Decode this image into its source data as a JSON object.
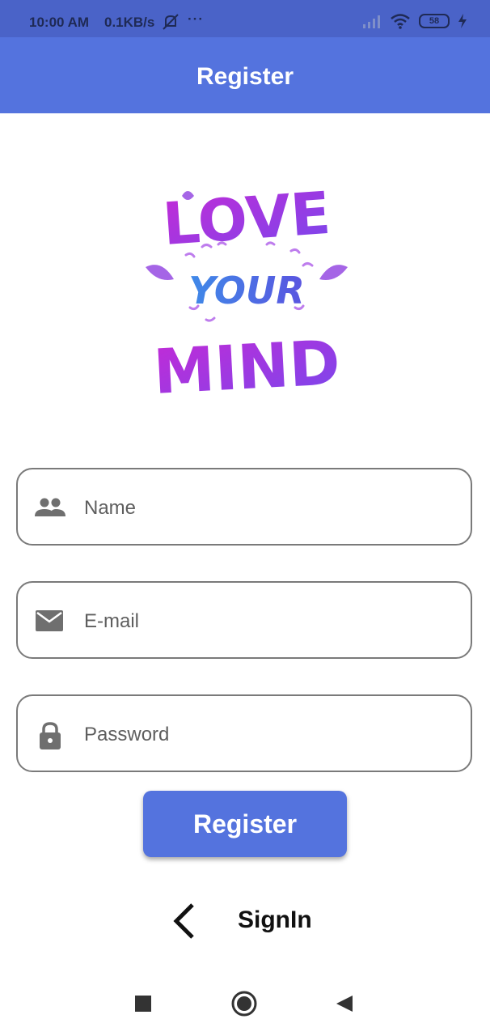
{
  "status_bar": {
    "time": "10:00 AM",
    "speed": "0.1KB/s",
    "dots": "···",
    "battery": "58"
  },
  "app_bar": {
    "title": "Register"
  },
  "logo": {
    "line1": "LOVE",
    "line2": "YOUR",
    "line3": "MIND"
  },
  "form": {
    "name": {
      "placeholder": "Name",
      "icon": "people-icon"
    },
    "email": {
      "placeholder": "E-mail",
      "icon": "mail-icon"
    },
    "password": {
      "placeholder": "Password",
      "icon": "lock-icon"
    }
  },
  "register_button": {
    "label": "Register"
  },
  "signin": {
    "label": "SignIn",
    "icon": "chevron-left-icon"
  },
  "colors": {
    "primary": "#5473de",
    "status_bar": "#4a63c8"
  }
}
